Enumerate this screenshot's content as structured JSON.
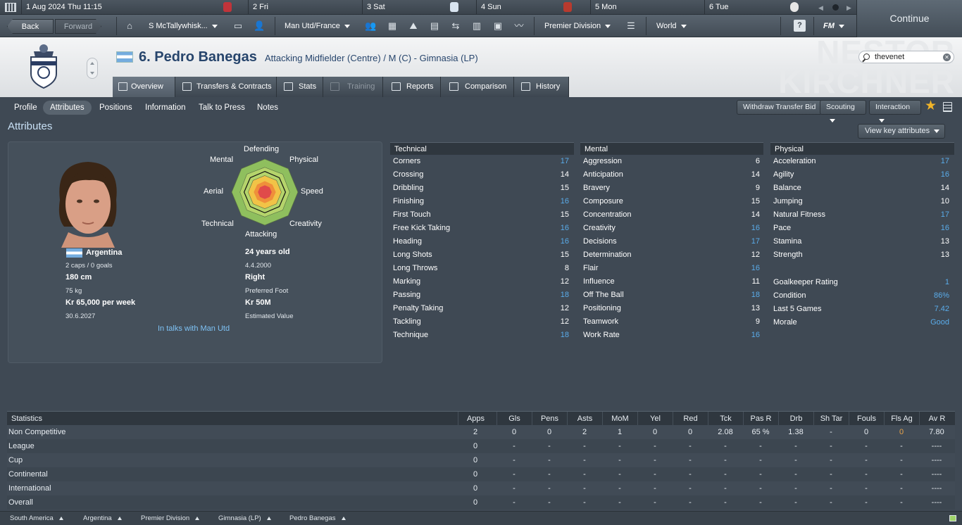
{
  "calendar": {
    "date": "1 Aug 2024",
    "time": "Thu 11:15",
    "days": [
      "2 Fri",
      "3 Sat",
      "4 Sun",
      "5 Mon",
      "6 Tue"
    ]
  },
  "continue_label": "Continue",
  "nav": {
    "back": "Back",
    "forward": "Forward",
    "manager": "S McTallywhisk...",
    "team": "Man Utd/France",
    "competition": "Premier Division",
    "world": "World",
    "fm": "FM"
  },
  "header": {
    "squad_number_name": "6. Pedro Banegas",
    "role": "Attacking Midfielder (Centre) / M (C) - Gimnasia (LP)",
    "background_text_1": "NESTOR",
    "background_text_2": "KIRCHNER",
    "search_value": "thevenet"
  },
  "tabs": [
    "Overview",
    "Transfers & Contracts",
    "Stats",
    "Training",
    "Reports",
    "Comparison",
    "History"
  ],
  "subnav": [
    "Profile",
    "Attributes",
    "Positions",
    "Information",
    "Talk to Press",
    "Notes"
  ],
  "actions": {
    "withdraw": "Withdraw Transfer Bid",
    "scouting": "Scouting",
    "interaction": "Interaction",
    "view_key": "View key attributes"
  },
  "section_title": "Attributes",
  "radar": {
    "labels": [
      "Defending",
      "Physical",
      "Speed",
      "Creativity",
      "Attacking",
      "Technical",
      "Aerial",
      "Mental"
    ]
  },
  "profile": {
    "nationality": "Argentina",
    "caps": "2 caps / 0 goals",
    "height": "180 cm",
    "weight": "75 kg",
    "wage": "Kr 65,000 per week",
    "contract_end": "30.6.2027",
    "age": "24 years old",
    "dob": "4.4.2000",
    "foot": "Right",
    "foot_label": "Preferred Foot",
    "value": "Kr 50M",
    "value_label": "Estimated Value",
    "status": "In talks with Man Utd"
  },
  "technical": {
    "title": "Technical",
    "rows": [
      [
        "Corners",
        "17"
      ],
      [
        "Crossing",
        "14"
      ],
      [
        "Dribbling",
        "15"
      ],
      [
        "Finishing",
        "16"
      ],
      [
        "First Touch",
        "15"
      ],
      [
        "Free Kick Taking",
        "16"
      ],
      [
        "Heading",
        "16"
      ],
      [
        "Long Shots",
        "15"
      ],
      [
        "Long Throws",
        "8"
      ],
      [
        "Marking",
        "12"
      ],
      [
        "Passing",
        "18"
      ],
      [
        "Penalty Taking",
        "12"
      ],
      [
        "Tackling",
        "12"
      ],
      [
        "Technique",
        "18"
      ]
    ]
  },
  "mental": {
    "title": "Mental",
    "rows": [
      [
        "Aggression",
        "6"
      ],
      [
        "Anticipation",
        "14"
      ],
      [
        "Bravery",
        "9"
      ],
      [
        "Composure",
        "15"
      ],
      [
        "Concentration",
        "14"
      ],
      [
        "Creativity",
        "16"
      ],
      [
        "Decisions",
        "17"
      ],
      [
        "Determination",
        "12"
      ],
      [
        "Flair",
        "16"
      ],
      [
        "Influence",
        "11"
      ],
      [
        "Off The Ball",
        "18"
      ],
      [
        "Positioning",
        "13"
      ],
      [
        "Teamwork",
        "9"
      ],
      [
        "Work Rate",
        "16"
      ]
    ]
  },
  "physical": {
    "title": "Physical",
    "rows": [
      [
        "Acceleration",
        "17"
      ],
      [
        "Agility",
        "16"
      ],
      [
        "Balance",
        "14"
      ],
      [
        "Jumping",
        "10"
      ],
      [
        "Natural Fitness",
        "17"
      ],
      [
        "Pace",
        "16"
      ],
      [
        "Stamina",
        "13"
      ],
      [
        "Strength",
        "13"
      ]
    ],
    "extra": [
      [
        "Goalkeeper Rating",
        "1"
      ],
      [
        "Condition",
        "86%"
      ],
      [
        "Last 5 Games",
        "7.42"
      ],
      [
        "Morale",
        "Good"
      ]
    ]
  },
  "stats": {
    "headers": [
      "Statistics",
      "Apps",
      "Gls",
      "Pens",
      "Asts",
      "MoM",
      "Yel",
      "Red",
      "Tck",
      "Pas R",
      "Drb",
      "Sh Tar",
      "Fouls",
      "Fls Ag",
      "Av R"
    ],
    "rows": [
      [
        "Non Competitive",
        "2",
        "0",
        "0",
        "2",
        "1",
        "0",
        "0",
        "2.08",
        "65 %",
        "1.38",
        "-",
        "0",
        "0",
        "7.80"
      ],
      [
        "League",
        "0",
        "-",
        "-",
        "-",
        "-",
        "-",
        "-",
        "-",
        "-",
        "-",
        "-",
        "-",
        "-",
        "----"
      ],
      [
        "Cup",
        "0",
        "-",
        "-",
        "-",
        "-",
        "-",
        "-",
        "-",
        "-",
        "-",
        "-",
        "-",
        "-",
        "----"
      ],
      [
        "Continental",
        "0",
        "-",
        "-",
        "-",
        "-",
        "-",
        "-",
        "-",
        "-",
        "-",
        "-",
        "-",
        "-",
        "----"
      ],
      [
        "International",
        "0",
        "-",
        "-",
        "-",
        "-",
        "-",
        "-",
        "-",
        "-",
        "-",
        "-",
        "-",
        "-",
        "----"
      ],
      [
        "Overall",
        "0",
        "-",
        "-",
        "-",
        "-",
        "-",
        "-",
        "-",
        "-",
        "-",
        "-",
        "-",
        "-",
        "----"
      ]
    ]
  },
  "breadcrumbs": [
    "South America",
    "Argentina",
    "Premier Division",
    "Gimnasia (LP)",
    "Pedro Banegas"
  ],
  "colors": {
    "accent_blue": "#5aacea",
    "title_navy": "#27456c",
    "fls_ag_orange": "#e8a34a"
  }
}
